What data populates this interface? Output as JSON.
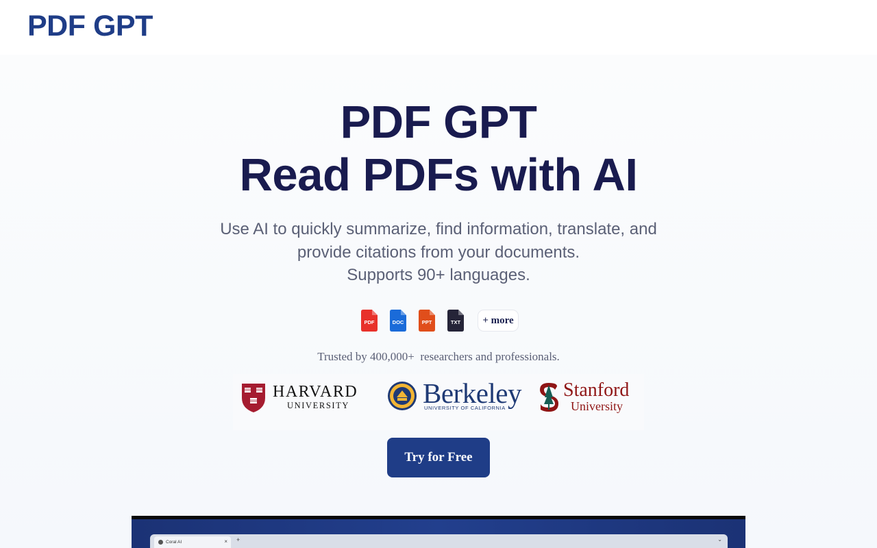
{
  "header": {
    "logo": "PDF GPT"
  },
  "hero": {
    "title_line1": "PDF GPT",
    "title_line2": "Read PDFs with AI",
    "subtitle_lines": [
      "Use AI to quickly summarize, find information, translate, and",
      "provide citations from your documents.",
      "Supports 90+ languages."
    ]
  },
  "formats": {
    "items": [
      {
        "label": "PDF",
        "color": "#e8312a",
        "icon": "pdf-file-icon"
      },
      {
        "label": "DOC",
        "color": "#1a6bd9",
        "icon": "doc-file-icon"
      },
      {
        "label": "PPT",
        "color": "#e04e1b",
        "icon": "ppt-file-icon"
      },
      {
        "label": "TXT",
        "color": "#252438",
        "icon": "txt-file-icon"
      }
    ],
    "more_label": "+ more"
  },
  "trusted": {
    "text": "Trusted by 400,000+  researchers and professionals."
  },
  "logos": {
    "harvard": {
      "name": "HARVARD",
      "sub": "UNIVERSITY"
    },
    "berkeley": {
      "name": "Berkeley",
      "sub": "UNIVERSITY OF CALIFORNIA"
    },
    "stanford": {
      "name": "Stanford",
      "sub": "University"
    }
  },
  "cta": {
    "label": "Try for Free"
  },
  "preview": {
    "tab_title": "Coral AI"
  },
  "colors": {
    "brand": "#1f3d87",
    "heading": "#191b4f",
    "body_text": "#5b6076"
  }
}
